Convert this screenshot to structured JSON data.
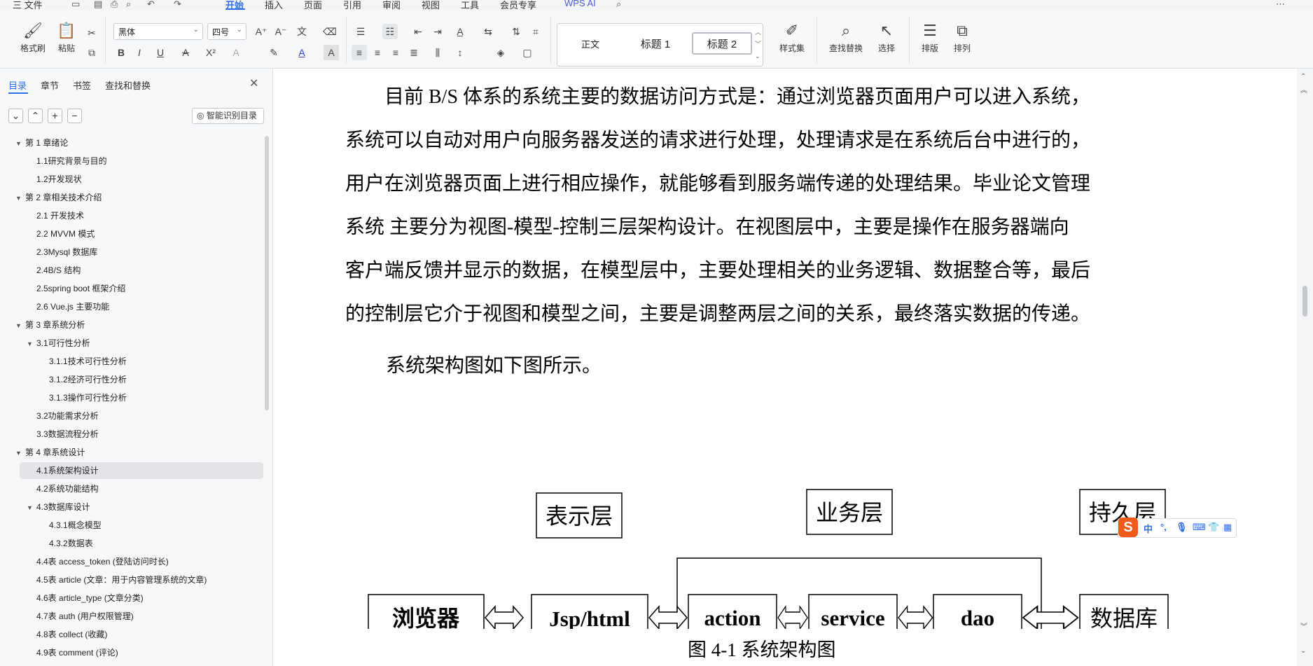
{
  "menubar": {
    "file": "三 文件",
    "tabs": [
      "开始",
      "插入",
      "页面",
      "引用",
      "审阅",
      "视图",
      "工具",
      "会员专享"
    ],
    "active_tab": "开始",
    "wps_ai": "WPS AI"
  },
  "ribbon": {
    "format_painter": "格式刷",
    "paste": "粘贴",
    "font_name": "黑体",
    "font_size": "四号",
    "styles": [
      "正文",
      "标题 1",
      "标题 2"
    ],
    "style_set": "样式集",
    "find_replace": "查找替换",
    "select": "选择",
    "layout": "排版",
    "arrange": "排列"
  },
  "nav": {
    "tabs": [
      "目录",
      "章节",
      "书签",
      "查找和替换"
    ],
    "smart_toc": "智能识别目录",
    "toc": [
      {
        "text": "第 1 章绪论",
        "level": 0,
        "caret": true
      },
      {
        "text": "1.1研究背景与目的",
        "level": 1
      },
      {
        "text": "1.2开发现状",
        "level": 1
      },
      {
        "text": "第 2 章相关技术介绍",
        "level": 0,
        "caret": true
      },
      {
        "text": "2.1  开发技术",
        "level": 1
      },
      {
        "text": "2.2  MVVM 模式",
        "level": 1
      },
      {
        "text": "2.3Mysql 数据库",
        "level": 1
      },
      {
        "text": "2.4B/S 结构",
        "level": 1
      },
      {
        "text": "2.5spring boot 框架介绍",
        "level": 1
      },
      {
        "text": "2.6    Vue.js  主要功能",
        "level": 1
      },
      {
        "text": "第 3 章系统分析",
        "level": 0,
        "caret": true
      },
      {
        "text": "3.1可行性分析",
        "level": 1,
        "caret": true
      },
      {
        "text": "3.1.1技术可行性分析",
        "level": 2
      },
      {
        "text": "3.1.2经济可行性分析",
        "level": 2
      },
      {
        "text": "3.1.3操作可行性分析",
        "level": 2
      },
      {
        "text": "3.2功能需求分析",
        "level": 1
      },
      {
        "text": "3.3数据流程分析",
        "level": 1
      },
      {
        "text": "第 4 章系统设计",
        "level": 0,
        "caret": true
      },
      {
        "text": "4.1系统架构设计",
        "level": 1,
        "selected": true
      },
      {
        "text": "4.2系统功能结构",
        "level": 1
      },
      {
        "text": "4.3数据库设计",
        "level": 1,
        "caret": true
      },
      {
        "text": "4.3.1概念模型",
        "level": 2
      },
      {
        "text": "4.3.2数据表",
        "level": 2
      },
      {
        "text": "4.4表 access_token (登陆访问时长)",
        "level": 1
      },
      {
        "text": "4.5表 article (文章：用于内容管理系统的文章)",
        "level": 1
      },
      {
        "text": "4.6表 article_type (文章分类)",
        "level": 1
      },
      {
        "text": "4.7表 auth (用户权限管理)",
        "level": 1
      },
      {
        "text": "4.8表 collect (收藏)",
        "level": 1
      },
      {
        "text": "4.9表 comment (评论)",
        "level": 1
      }
    ]
  },
  "doc": {
    "lines": [
      "目前 B/S 体系的系统主要的数据访问方式是：通过浏览器页面用户可以进入系统，",
      "系统可以自动对用户向服务器发送的请求进行处理，处理请求是在系统后台中进行的，",
      "用户在浏览器页面上进行相应操作，就能够看到服务端传递的处理结果。毕业论文管理",
      "系统  主要分为视图-模型-控制三层架构设计。在视图层中，主要是操作在服务器端向",
      "客户端反馈并显示的数据，在模型层中，主要处理相关的业务逻辑、数据整合等，最后",
      "的控制层它介于视图和模型之间，主要是调整两层之间的关系，最终落实数据的传递。"
    ],
    "caption_intro": "系统架构图如下图所示。",
    "diagram": {
      "layers": [
        "表示层",
        "业务层",
        "持久层"
      ],
      "nodes": [
        "浏览器",
        "Jsp/html",
        "action",
        "service",
        "dao",
        "数据库"
      ]
    },
    "figure_caption": "图 4-1 系统架构图"
  },
  "ime": {
    "logo": "S",
    "mode": "中"
  }
}
